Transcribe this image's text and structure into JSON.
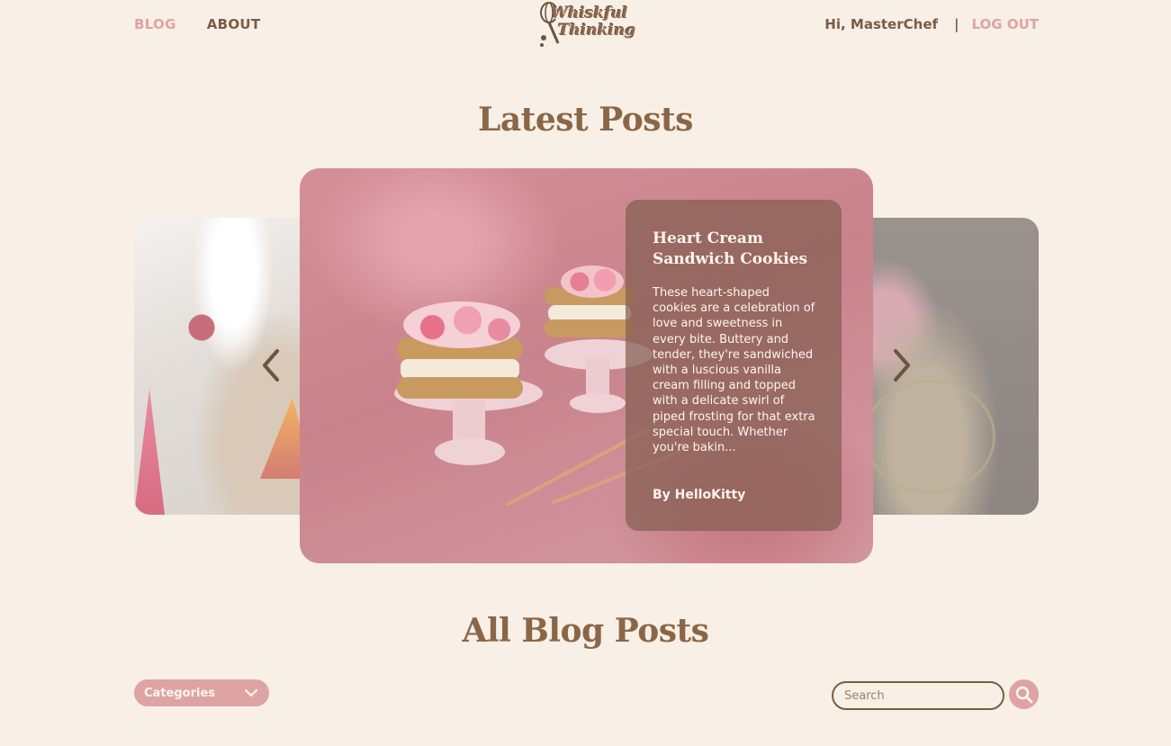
{
  "header": {
    "nav": {
      "blog": "BLOG",
      "about": "ABOUT"
    },
    "logo": {
      "line1": "Whiskful",
      "line2": "Thinking"
    },
    "greeting": "Hi, MasterChef",
    "separator": "|",
    "logout": "LOG OUT"
  },
  "latest": {
    "title": "Latest Posts",
    "featured_post": {
      "title": "Heart Cream Sandwich Cookies",
      "excerpt": "These heart-shaped cookies are a celebration of love and sweetness in every bite. Buttery and tender, they're sandwiched with a luscious vanilla cream filling and topped with a delicate swirl of piped frosting for that extra special touch. Whether you're bakin...",
      "author": "By HelloKitty"
    }
  },
  "all_posts": {
    "title": "All Blog Posts",
    "categories_label": "Categories",
    "search_placeholder": "Search"
  },
  "colors": {
    "background": "#f8efe6",
    "accent_pink": "#dea3a3",
    "brown": "#7a5c44",
    "overlay": "#845e50"
  },
  "icons": [
    "whisk-logo-icon",
    "chevron-left-icon",
    "chevron-right-icon",
    "chevron-down-icon",
    "search-icon"
  ]
}
